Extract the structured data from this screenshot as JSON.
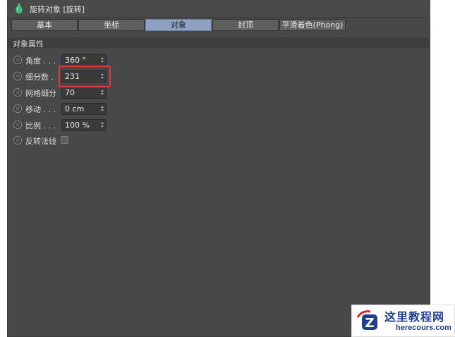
{
  "window": {
    "title": "旋转对象 [旋转]",
    "icon": "lathe-vase-icon"
  },
  "tabs": [
    {
      "label": "基本",
      "active": false
    },
    {
      "label": "坐标",
      "active": false
    },
    {
      "label": "对象",
      "active": true
    },
    {
      "label": "封顶",
      "active": false
    },
    {
      "label": "平滑着色(Phong)",
      "active": false
    }
  ],
  "section": {
    "title": "对象属性"
  },
  "properties": [
    {
      "label": "角度 . . .",
      "value": "360 °"
    },
    {
      "label": "细分数 .",
      "value": "231"
    },
    {
      "label": "网格细分",
      "value": "70"
    },
    {
      "label": "移动 . . .",
      "value": "0 cm"
    },
    {
      "label": "比例 . . .",
      "value": "100 %"
    },
    {
      "label": "反转法线",
      "checked": false
    }
  ],
  "colors": {
    "panel": "#484848",
    "active_tab": "#8da2c3",
    "highlight": "#e0383b"
  },
  "watermark": {
    "title": "这里教程网",
    "subtitle": "herecours.com"
  }
}
